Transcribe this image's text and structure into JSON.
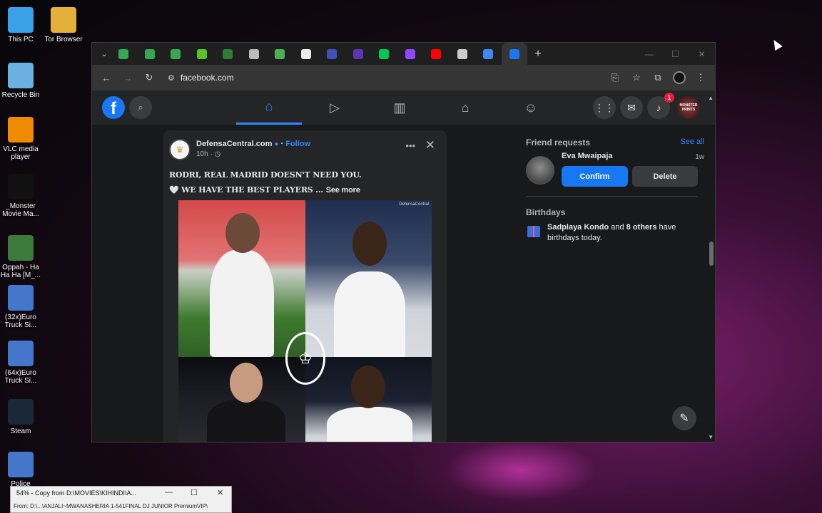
{
  "desktop": {
    "icons": [
      {
        "label": "This PC",
        "color": "#3aa0e8"
      },
      {
        "label": "Tor Browser",
        "color": "#e3b13a"
      },
      {
        "label": "Recycle Bin",
        "color": "#6ab0e0"
      },
      {
        "label": "VLC media player",
        "color": "#f08a00"
      },
      {
        "label": "_Monster Movie Ma...",
        "color": "#111111"
      },
      {
        "label": "Oppah - Ha Ha Ha [M_...",
        "color": "#3b7a3b"
      },
      {
        "label": "(32x)Euro Truck Si...",
        "color": "#4477cc"
      },
      {
        "label": "(64x)Euro Truck Si...",
        "color": "#4477cc"
      },
      {
        "label": "Steam",
        "color": "#1b2838"
      },
      {
        "label": "Police",
        "color": "#4477cc"
      }
    ]
  },
  "browser": {
    "url": "facebook.com",
    "tab_colors": [
      "#34a853",
      "#34a853",
      "#34a853",
      "#58c322",
      "#2e7d32",
      "#bbbbbb",
      "#4caf50",
      "#eeeeee",
      "#3f51b5",
      "#5e35b1",
      "#00c853",
      "#9146ff",
      "#ff0000",
      "#cccccc",
      "#4285f4",
      "#1877f2"
    ],
    "new_tab": "+",
    "icons": {
      "back": "←",
      "forward": "→",
      "reload": "↻",
      "site_info": "⚙",
      "cast": "⎘",
      "star": "☆",
      "extensions": "⧉",
      "menu": "⋮"
    }
  },
  "facebook": {
    "logo": "f",
    "notification_count": "1",
    "profile_text": "MONSTER PRINTS",
    "post": {
      "page_name": "DefensaCentral.com",
      "verified": "●",
      "follow": "Follow",
      "time": "10h · ◷",
      "line1": "RODRI, REAL MADRID DOESN'T NEED YOU.",
      "line2": "🤍 WE HAVE THE BEST PLAYERS ...",
      "see_more": "See more",
      "watermark": "DefensaCentral",
      "more_icon": "•••",
      "close_icon": "✕"
    },
    "friend_requests": {
      "title": "Friend requests",
      "see_all": "See all",
      "name": "Eva Mwaipaja",
      "age": "1w",
      "confirm": "Confirm",
      "delete": "Delete"
    },
    "birthdays": {
      "title": "Birthdays",
      "name": "Sadplaya Kondo",
      "and": " and ",
      "others": "8 others",
      "suffix": " have birthdays today."
    }
  },
  "copy_dialog": {
    "title": "54% - Copy from D:\\MOVIES\\KIHINDI\\A...",
    "from": "From:  D:\\...\\ANJALI~MWANASHERIA 1-541FINAL DJ JUNIOR PremiumVIP\\"
  }
}
